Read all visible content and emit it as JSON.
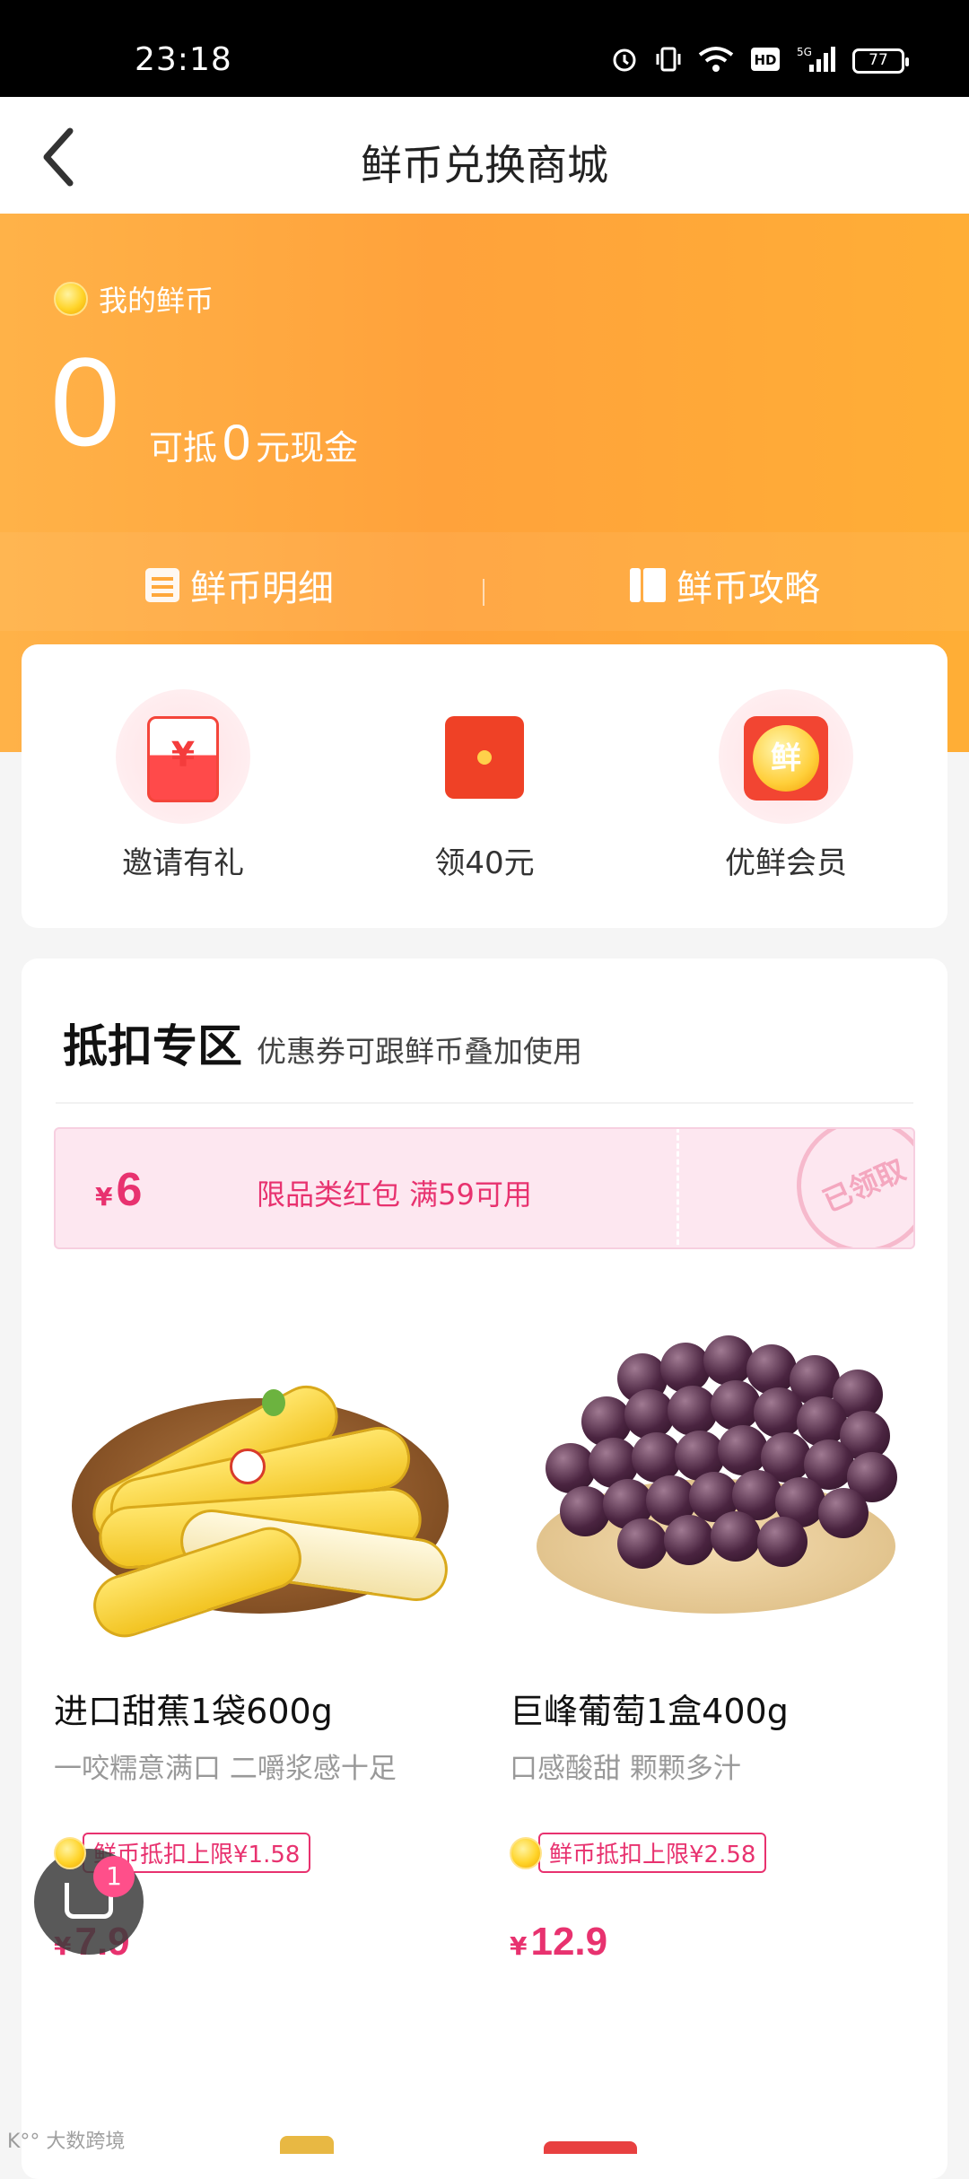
{
  "status_bar": {
    "time": "23:18",
    "icons": [
      "alarm-icon",
      "vibrate-icon",
      "wifi-icon",
      "hd-icon",
      "5g-signal-icon"
    ],
    "battery": "77"
  },
  "navbar": {
    "title": "鲜币兑换商城",
    "back_icon": "chevron-left-icon"
  },
  "hero": {
    "label": "我的鲜币",
    "amount": "0",
    "cash_prefix": "可抵",
    "cash_amount": "0",
    "cash_suffix": "元现金",
    "links": [
      {
        "label": "鲜币明细",
        "icon": "document-icon"
      },
      {
        "label": "鲜币攻略",
        "icon": "book-icon"
      }
    ]
  },
  "quick_actions": [
    {
      "label": "邀请有礼",
      "icon": "envelope-icon",
      "glyph": "¥"
    },
    {
      "label": "领40元",
      "icon": "red-packet-icon"
    },
    {
      "label": "优鲜会员",
      "icon": "vip-coin-icon",
      "glyph": "鲜"
    }
  ],
  "section": {
    "title": "抵扣专区",
    "subtitle": "优惠券可跟鲜币叠加使用"
  },
  "coupon": {
    "currency": "¥",
    "amount": "6",
    "description": "限品类红包 满59可用",
    "stamp": "已领取"
  },
  "products": [
    {
      "name": "进口甜蕉1袋600g",
      "desc": "一咬糯意满口 二嚼浆感十足",
      "tag": "鲜币抵扣上限¥1.58",
      "currency": "¥",
      "price": "7.9"
    },
    {
      "name": "巨峰葡萄1盒400g",
      "desc": "口感酸甜 颗颗多汁",
      "tag": "鲜币抵扣上限¥2.58",
      "currency": "¥",
      "price": "12.9"
    }
  ],
  "cart": {
    "badge": "1"
  },
  "watermark": "K°° 大数跨境",
  "colors": {
    "accent_orange": "#ffa83a",
    "price_pink": "#e8326f",
    "coupon_bg": "#fde7f0"
  }
}
